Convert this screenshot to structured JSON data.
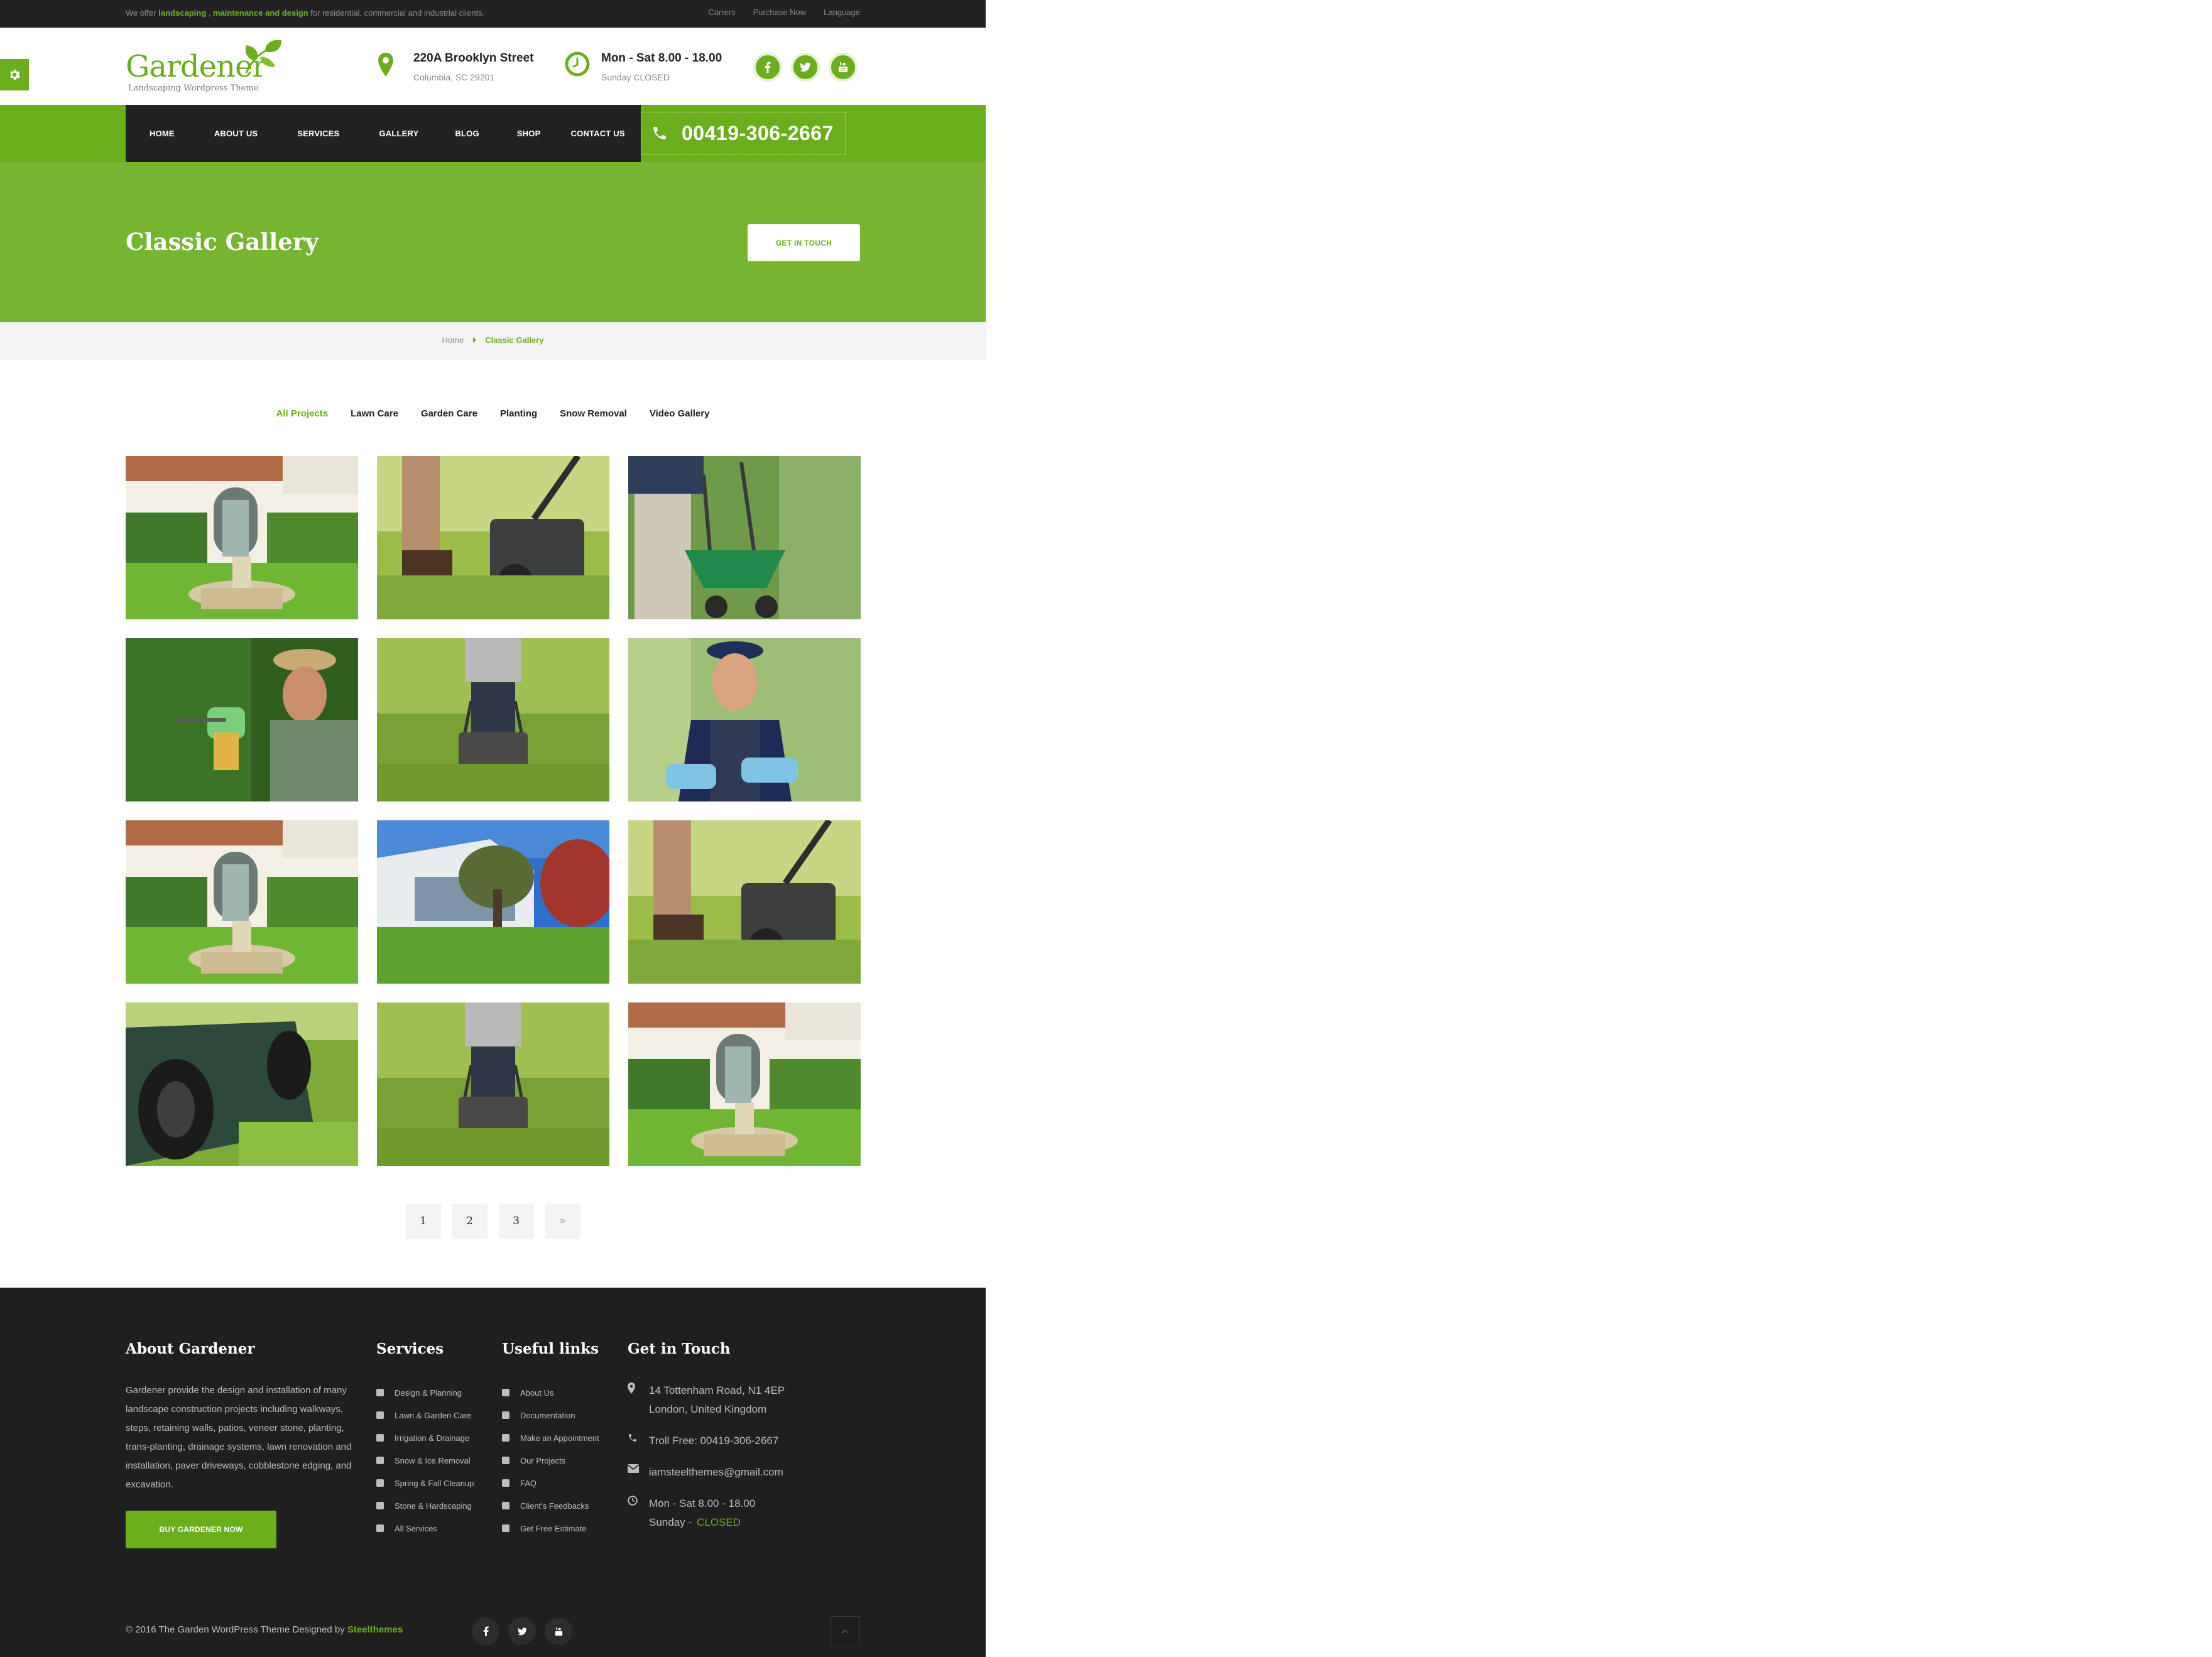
{
  "topbar": {
    "offer_prefix": "We offer",
    "offer_hl1": "landscaping",
    "offer_sep": " , ",
    "offer_hl2": "maintenance and design",
    "offer_suffix": "for residential, commercial and industrial clients.",
    "links": [
      "Carrers",
      "Purchase Now",
      "Language"
    ]
  },
  "logo": {
    "name": "Gardener",
    "tagline": "Landscaping Wordpress Theme"
  },
  "header": {
    "address_title": "220A Brooklyn Street",
    "address_sub": "Columbia, SC 29201",
    "hours_title": "Mon - Sat 8.00 - 18.00",
    "hours_sub": "Sunday CLOSED",
    "social_icons": [
      "facebook-icon",
      "twitter-icon",
      "youtube-icon"
    ]
  },
  "nav": {
    "items": [
      "HOME",
      "ABOUT US",
      "SERVICES",
      "GALLERY",
      "BLOG",
      "SHOP",
      "CONTACT US"
    ],
    "phone": "00419-306-2667"
  },
  "hero": {
    "title": "Classic Gallery",
    "cta": "GET IN TOUCH"
  },
  "breadcrumb": {
    "home": "Home",
    "current": "Classic Gallery"
  },
  "filters": {
    "items": [
      "All Projects",
      "Lawn Care",
      "Garden Care",
      "Planting",
      "Snow Removal",
      "Video Gallery"
    ],
    "active": "All Projects"
  },
  "gallery": {
    "tiles": [
      "house-fountain",
      "mower-closeup",
      "spreader",
      "gardener-trimming",
      "man-mowing",
      "woman-gardener",
      "house-fountain",
      "modern-house-lawn",
      "mower-closeup",
      "mower-wheel",
      "man-mowing",
      "house-fountain"
    ]
  },
  "pagination": {
    "pages": [
      "1",
      "2",
      "3",
      "»"
    ]
  },
  "footer": {
    "about_title": "About Gardener",
    "about_text": "Gardener provide the design and installation of many landscape construction projects including walkways, steps, retaining walls, patios, veneer stone, planting, trans-planting, drainage systems, lawn renovation and installation, paver driveways, cobblestone edging, and excavation.",
    "buy_button": "BUY GARDENER NOW",
    "services_title": "Services",
    "services": [
      "Design & Planning",
      "Lawn & Garden Care",
      "Irrigation & Drainage",
      "Snow & Ice Removal",
      "Spring & Fall Cleanup",
      "Stone & Hardscaping",
      "All Services"
    ],
    "links_title": "Useful links",
    "links": [
      "About Us",
      "Documentation",
      "Make an Appointment",
      "Our Projects",
      "FAQ",
      "Client's Feedbacks",
      "Get Free Estimate"
    ],
    "contact_title": "Get in Touch",
    "address_line1": "14 Tottenham Road, N1 4EP",
    "address_line2": "London, United Kingdom",
    "tollfree": "Troll Free: 00419-306-2667",
    "email": "iamsteelthemes@gmail.com",
    "hours_line1": "Mon - Sat 8.00 - 18.00",
    "hours_line2": "Sunday -",
    "closed": "CLOSED",
    "copyright_prefix": "© 2016 The Garden WordPress Theme Designed by",
    "copyright_brand": "Steelthemes"
  },
  "colors": {
    "accent": "#6aae1b",
    "hero": "#76b530",
    "dark": "#222222",
    "footer": "#1f1f1f"
  }
}
